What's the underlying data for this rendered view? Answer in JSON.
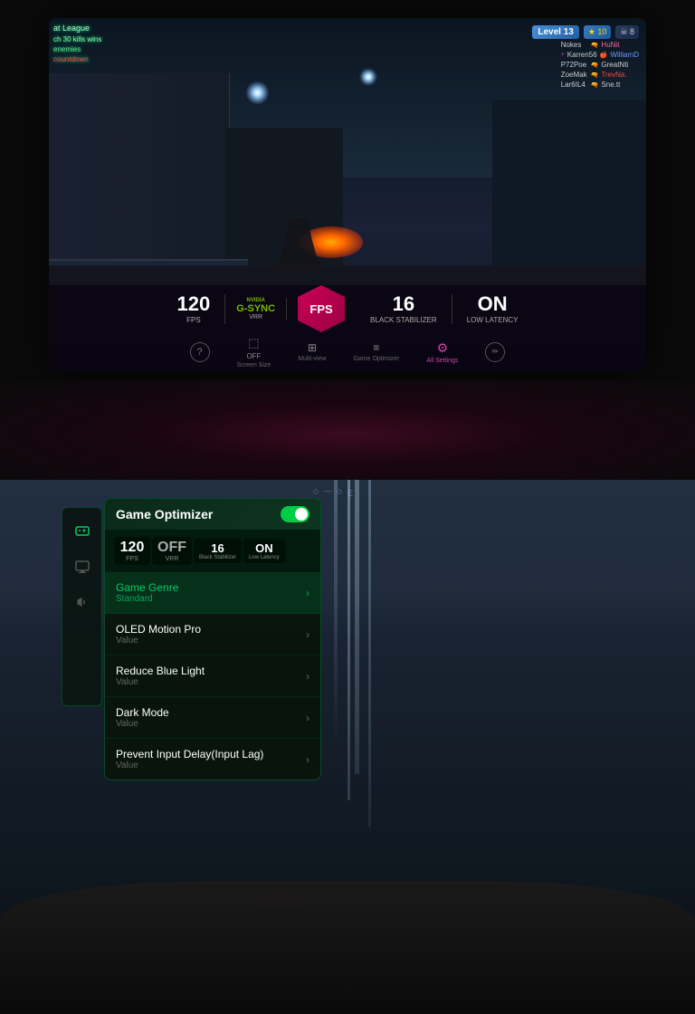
{
  "top": {
    "hud": {
      "topleft_lines": [
        "at League",
        "ch 30 kills wins",
        "enemies",
        "countdown"
      ],
      "level": "Level 13",
      "stars": "★ 10",
      "skull": "☠ 8"
    },
    "scoreboard": [
      {
        "name": "Nokes",
        "icon": "🔫",
        "val1": "HuNit",
        "col1": "pink"
      },
      {
        "name": "Karren56",
        "icon": "🍎",
        "val1": "WilliamD",
        "col1": "blue"
      },
      {
        "name": "P72Poe",
        "icon": "🔫",
        "val1": "GreatNti",
        "col1": "white"
      },
      {
        "name": "ZoeMak",
        "icon": "🔫",
        "val1": "TrevNa.",
        "col1": "red"
      },
      {
        "name": "Lar6IL4",
        "icon": "🔫",
        "val1": "Sne.tt",
        "col1": "white"
      }
    ],
    "stats": {
      "fps_val": "120",
      "fps_label": "FPS",
      "gsync_brand": "NVIDIA",
      "gsync_name": "G-SYNC",
      "gsync_sub": "VRR",
      "center_label": "FPS",
      "black_val": "16",
      "black_label": "Black Stabilizer",
      "latency_val": "ON",
      "latency_label": "Low Latency"
    },
    "controls": [
      {
        "icon": "?",
        "label": "",
        "active": false,
        "is_circle": true
      },
      {
        "icon": "⬜",
        "label": "Screen Size",
        "active": false,
        "text_val": "OFF"
      },
      {
        "icon": "⊞",
        "label": "Multi-view",
        "active": false
      },
      {
        "icon": "≡",
        "label": "Game Optimizer",
        "active": false
      },
      {
        "icon": "⚙",
        "label": "All Settings",
        "active": true
      },
      {
        "icon": "✏",
        "label": "",
        "active": false,
        "is_circle": true
      }
    ]
  },
  "bottom": {
    "panel": {
      "title": "Game Optimizer",
      "toggle_on": true,
      "stats": [
        {
          "val": "120",
          "label": "FPS"
        },
        {
          "val": "OFF",
          "label": "VRR"
        },
        {
          "val": "16",
          "label": "Black Stabilizer"
        },
        {
          "val": "ON",
          "label": "Low Latency"
        }
      ],
      "menu_items": [
        {
          "title": "Game Genre",
          "value": "Standard",
          "active": true,
          "title_color": "green",
          "value_color": "green"
        },
        {
          "title": "OLED Motion Pro",
          "value": "Value",
          "active": false,
          "title_color": "white",
          "value_color": "gray"
        },
        {
          "title": "Reduce Blue Light",
          "value": "Value",
          "active": false,
          "title_color": "white",
          "value_color": "gray"
        },
        {
          "title": "Dark Mode",
          "value": "Value",
          "active": false,
          "title_color": "white",
          "value_color": "gray"
        },
        {
          "title": "Prevent Input Delay(Input Lag)",
          "value": "Value",
          "active": false,
          "title_color": "white",
          "value_color": "gray"
        }
      ]
    }
  }
}
